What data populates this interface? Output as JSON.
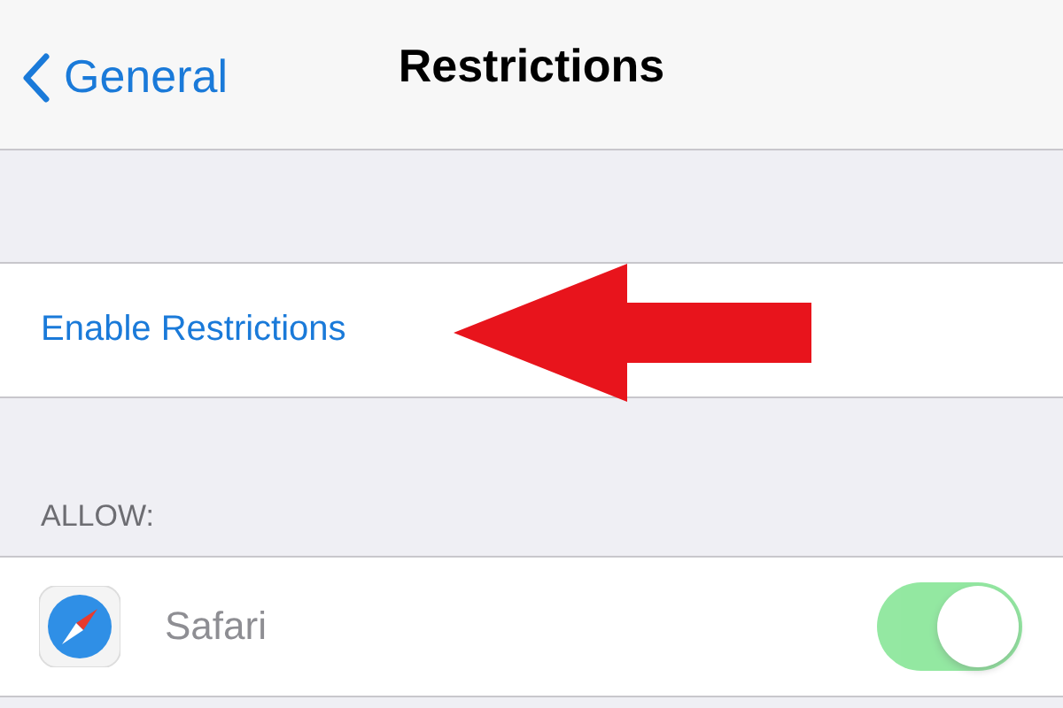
{
  "nav": {
    "back": "General",
    "title": "Restrictions"
  },
  "enable_button": {
    "label": "Enable Restrictions"
  },
  "annotation": {
    "kind": "arrow"
  },
  "allow": {
    "header": "ALLOW:",
    "rows": [
      {
        "label": "Safari",
        "on": true,
        "disabled": true
      }
    ]
  }
}
